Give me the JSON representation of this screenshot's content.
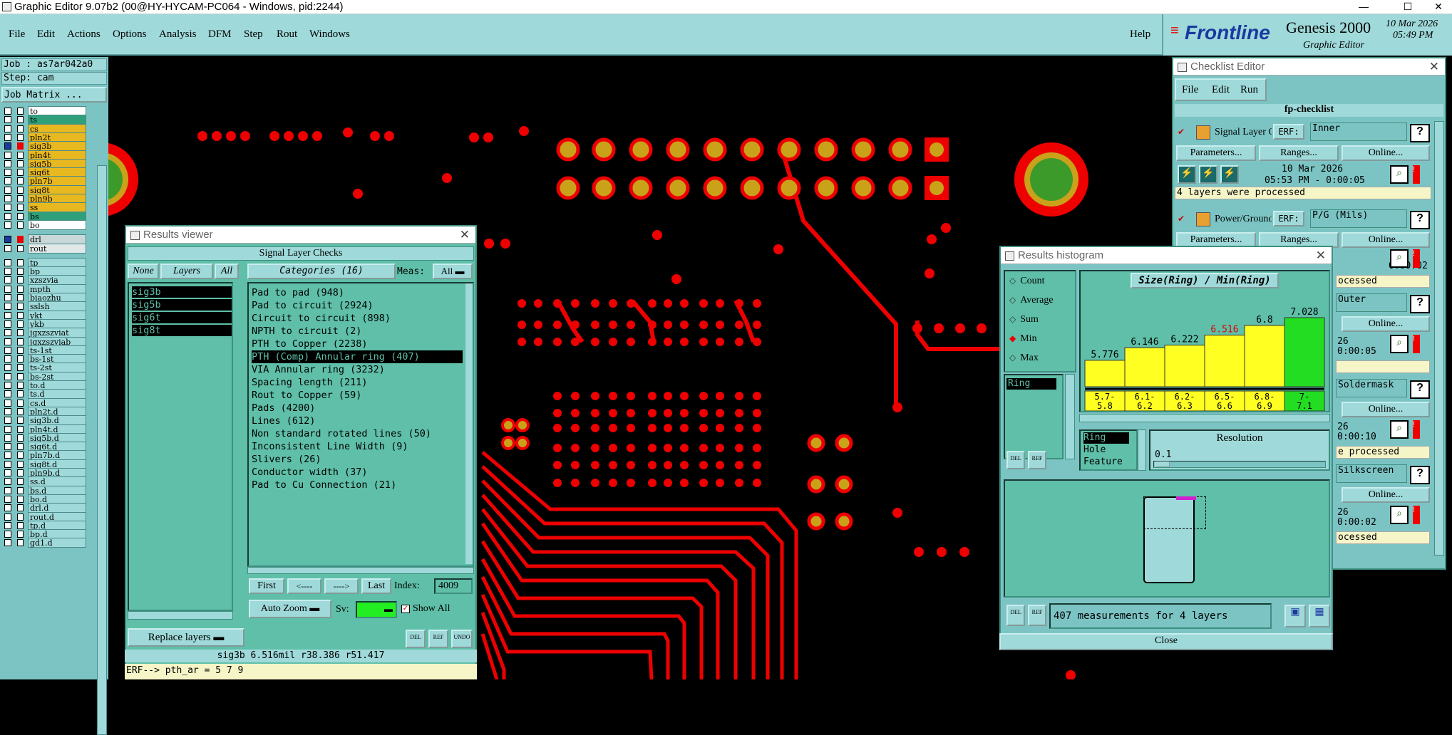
{
  "window": {
    "title": "Graphic Editor 9.07b2 (00@HY-HYCAM-PC064 - Windows, pid:2244)"
  },
  "menu": [
    "File",
    "Edit",
    "Actions",
    "Options",
    "Analysis",
    "DFM",
    "Step",
    "Rout",
    "Windows"
  ],
  "help_label": "Help",
  "brand": {
    "logo": "Frontline",
    "product": "Genesis 2000",
    "sub": "Graphic Editor",
    "date": "10 Mar 2026",
    "time": "05:49 PM"
  },
  "job": {
    "job_label": "Job : as7ar042a0",
    "step_label": "Step: cam",
    "matrix_button": "Job Matrix ..."
  },
  "layers_group1": [
    {
      "name": "to",
      "color": "#ffffff"
    },
    {
      "name": "ts",
      "color": "#2fa07a"
    },
    {
      "name": "cs",
      "color": "#e8b820"
    },
    {
      "name": "pln2t",
      "color": "#e8b820"
    },
    {
      "name": "sig3b",
      "color": "#e8b820"
    },
    {
      "name": "pln4t",
      "color": "#e8b820"
    },
    {
      "name": "sig5b",
      "color": "#e8b820"
    },
    {
      "name": "sig6t",
      "color": "#e8b820"
    },
    {
      "name": "pln7b",
      "color": "#e8b820"
    },
    {
      "name": "sig8t",
      "color": "#e8b820"
    },
    {
      "name": "pln9b",
      "color": "#e8b820"
    },
    {
      "name": "ss",
      "color": "#e8b820"
    },
    {
      "name": "bs",
      "color": "#2fa07a"
    },
    {
      "name": "bo",
      "color": "#ffffff"
    }
  ],
  "layers_group2": [
    {
      "name": "drl",
      "color": "#c8d8d8"
    },
    {
      "name": "rout",
      "color": "#e0e8e8"
    }
  ],
  "layers_group3": [
    "tp",
    "bp",
    "xzszvia",
    "mpth",
    "biaozhu",
    "sslsh",
    "ykt",
    "ykb",
    "jgxzszviat",
    "jgxzszviab",
    "ts-1st",
    "bs-1st",
    "ts-2st",
    "bs-2st",
    "to.d",
    "ts.d",
    "cs.d",
    "pln2t.d",
    "sig3b.d",
    "pln4t.d",
    "sig5b.d",
    "sig6t.d",
    "pln7b.d",
    "sig8t.d",
    "pln9b.d",
    "ss.d",
    "bs.d",
    "bo.d",
    "drl.d",
    "rout.d",
    "tp.d",
    "bp.d",
    "gd1.d"
  ],
  "results_viewer": {
    "title": "Results viewer",
    "header": "Signal Layer Checks",
    "none_btn": "None",
    "layers_btn": "Layers",
    "all_btn": "All",
    "categories_btn": "Categories (16)",
    "meas_label": "Meas:",
    "meas_value": "All",
    "layers": [
      "sig3b",
      "sig5b",
      "sig6t",
      "sig8t"
    ],
    "categories": [
      "Pad to pad (948)",
      "Pad to circuit (2924)",
      "Circuit to circuit (898)",
      "NPTH to circuit (2)",
      "PTH to Copper (2238)",
      "PTH (Comp) Annular ring (407)",
      "VIA Annular ring (3232)",
      "Spacing length (211)",
      "Rout to Copper (59)",
      "Pads (4200)",
      "Lines (612)",
      "Non standard rotated lines (50)",
      "Inconsistent Line Width (9)",
      "Slivers (26)",
      "Conductor width (37)",
      "Pad to Cu Connection (21)"
    ],
    "selected_category": "PTH (Comp) Annular ring (407)",
    "nav": {
      "first": "First",
      "prev": "<----",
      "next": "---->",
      "last": "Last",
      "index_label": "Index:",
      "index_value": "4009"
    },
    "auto_zoom": "Auto Zoom",
    "sv_label": "Sv:",
    "show_all": "Show All",
    "replace_layers": "Replace layers",
    "status": "sig3b 6.516mil  r38.386  r51.417",
    "erf": "ERF--> pth_ar = 5 7 9"
  },
  "histogram": {
    "title": "Results histogram",
    "options": [
      "Count",
      "Average",
      "Sum",
      "Min",
      "Max"
    ],
    "selected_option": "Min",
    "list_item": "Ring",
    "chart_title": "Size(Ring) / Min(Ring)",
    "types": [
      "Ring",
      "Hole",
      "Feature"
    ],
    "resolution_label": "Resolution",
    "resolution_value": "0.1",
    "footer": "407 measurements for 4 layers",
    "close": "Close"
  },
  "chart_data": {
    "type": "bar",
    "title": "Size(Ring) / Min(Ring)",
    "categories": [
      "5.7-5.8",
      "6.1-6.2",
      "6.2-6.3",
      "6.5-6.6",
      "6.8-6.9",
      "7-7.1"
    ],
    "values": [
      5.776,
      6.146,
      6.222,
      6.516,
      6.8,
      7.028
    ],
    "value_labels": [
      "5.776",
      "6.146",
      "6.222",
      "6.516",
      "6.8",
      "7.028"
    ],
    "category_labels_top": [
      "5.7-",
      "6.1-",
      "6.2-",
      "6.5-",
      "6.8-",
      "7-"
    ],
    "category_labels_bottom": [
      "5.8",
      "6.2",
      "6.3",
      "6.6",
      "6.9",
      "7.1"
    ],
    "colors": [
      "#ffff22",
      "#ffff22",
      "#ffff22",
      "#ffff22",
      "#ffff22",
      "#22dd22"
    ],
    "highlight_label_color": "#e00000",
    "highlight_index": 3
  },
  "checklist": {
    "title": "Checklist Editor",
    "menu": [
      "File",
      "Edit",
      "Run"
    ],
    "name": "fp-checklist",
    "items": [
      {
        "label": "Signal Layer Ch",
        "erf": "ERF:",
        "erf_value": "Inner",
        "params": "Parameters...",
        "ranges": "Ranges...",
        "online": "Online...",
        "date": "10 Mar 2026",
        "time": "05:53 PM - 0:00:05",
        "status": "4 layers were processed"
      },
      {
        "label": "Power/Ground C",
        "erf": "ERF:",
        "erf_value": "P/G (Mils)",
        "params": "Parameters...",
        "ranges": "Ranges...",
        "online": "Online...",
        "time": "0:00:02",
        "status": "ocessed"
      },
      {
        "erf_value": "Outer",
        "online": "Online...",
        "date": "26",
        "time": "0:00:05",
        "status": ""
      },
      {
        "erf_value": "Soldermask",
        "online": "Online...",
        "date": "26",
        "time": "0:00:10",
        "status": "e processed"
      },
      {
        "erf_value": "Silkscreen",
        "online": "Online...",
        "date": "26",
        "time": "0:00:02",
        "status": "ocessed"
      }
    ]
  }
}
